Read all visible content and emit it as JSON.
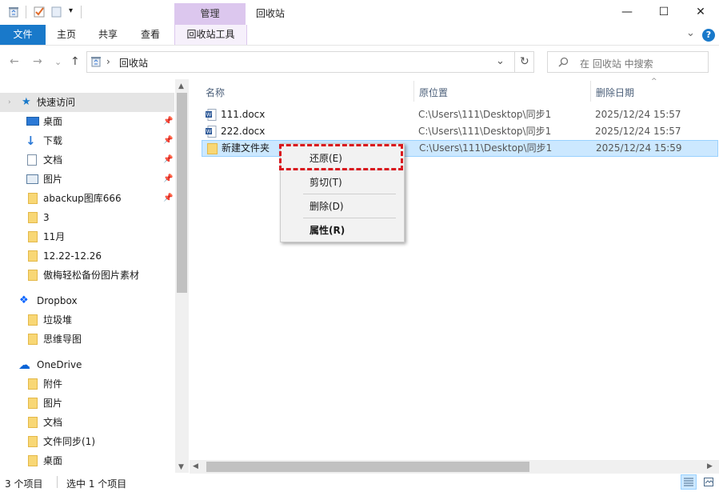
{
  "titlebar": {
    "manage_tab": "管理",
    "window_title": "回收站",
    "minimize_glyph": "—",
    "maximize_glyph": "☐",
    "close_glyph": "✕"
  },
  "ribbon": {
    "tabs": [
      "文件",
      "主页",
      "共享",
      "查看"
    ],
    "context_tab": "回收站工具",
    "collapse_glyph": "⌄",
    "help_glyph": "?"
  },
  "address": {
    "path": "回收站",
    "separator": "›",
    "refresh_glyph": "↻",
    "dropdown_glyph": "⌄"
  },
  "search": {
    "placeholder": "在 回收站 中搜索"
  },
  "nav": {
    "back": "←",
    "forward": "→",
    "recent": "⌄",
    "up": "↑"
  },
  "sidebar": {
    "quick_access": "快速访问",
    "quick_items": [
      {
        "label": "桌面",
        "pinned": true
      },
      {
        "label": "下载",
        "pinned": true
      },
      {
        "label": "文档",
        "pinned": true
      },
      {
        "label": "图片",
        "pinned": true
      },
      {
        "label": "abackup图库666",
        "pinned": true
      },
      {
        "label": "3",
        "pinned": false
      },
      {
        "label": "11月",
        "pinned": false
      },
      {
        "label": "12.22-12.26",
        "pinned": false
      },
      {
        "label": "傲梅轻松备份图片素材",
        "pinned": false
      }
    ],
    "dropbox": "Dropbox",
    "dropbox_items": [
      "垃圾堆",
      "思维导图"
    ],
    "onedrive": "OneDrive",
    "onedrive_items": [
      "附件",
      "图片",
      "文档",
      "文件同步(1)",
      "桌面"
    ]
  },
  "columns": {
    "name": "名称",
    "original_location": "原位置",
    "date_deleted": "删除日期"
  },
  "files": [
    {
      "name": "111.docx",
      "location": "C:\\Users\\111\\Desktop\\同步1",
      "date": "2025/12/24 15:57",
      "type": "docx",
      "selected": false
    },
    {
      "name": "222.docx",
      "location": "C:\\Users\\111\\Desktop\\同步1",
      "date": "2025/12/24 15:57",
      "type": "docx",
      "selected": false
    },
    {
      "name": "新建文件夹",
      "location": "C:\\Users\\111\\Desktop\\同步1",
      "date": "2025/12/24 15:59",
      "type": "folder",
      "selected": true
    }
  ],
  "context_menu": {
    "restore": "还原(E)",
    "cut": "剪切(T)",
    "delete": "删除(D)",
    "properties": "属性(R)"
  },
  "status": {
    "item_count": "3 个项目",
    "selected_count": "选中 1 个项目"
  },
  "colors": {
    "accent": "#1979ca",
    "manage_tab": "#dcc7ee",
    "selection": "#cce8ff",
    "highlight": "#d9181e"
  }
}
